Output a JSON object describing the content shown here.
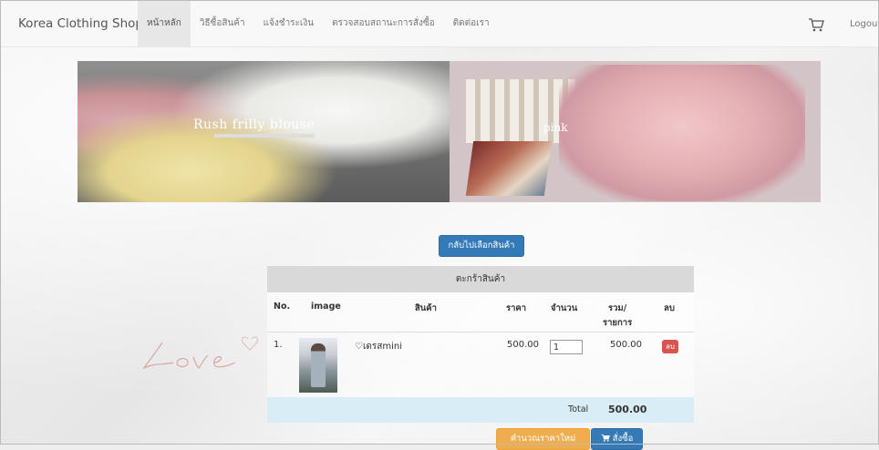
{
  "navbar": {
    "brand": "Korea Clothing Shop",
    "items": [
      {
        "label": "หน้าหลัก",
        "active": true
      },
      {
        "label": "วิธีซื้อสินค้า",
        "active": false
      },
      {
        "label": "แจ้งชำระเงิน",
        "active": false
      },
      {
        "label": "ตรวจสอบสถานะการสั่งซื้อ",
        "active": false
      },
      {
        "label": "ติดต่อเรา",
        "active": false
      }
    ],
    "cart_icon": "cart-icon",
    "logout": "Logout"
  },
  "banner": {
    "left_caption": "Rush frilly blouse",
    "right_caption": "pink"
  },
  "back_button": "กลับไปเลือกสินค้า",
  "cart": {
    "title": "ตะกร้าสินค้า",
    "headers": {
      "no": "No.",
      "image": "image",
      "product": "สินค้า",
      "price": "ราคา",
      "qty": "จำนวน",
      "subtotal_1": "รวม/",
      "subtotal_2": "รายการ",
      "delete": "ลบ"
    },
    "rows": [
      {
        "no": "1.",
        "name": "♡เดรสmini",
        "price": "500.00",
        "qty": "1",
        "subtotal": "500.00",
        "delete": "ลบ"
      }
    ],
    "total_label": "Total",
    "total_value": "500.00"
  },
  "actions": {
    "recalc": "คำนวณราคาใหม่",
    "order": "สั่งซื้อ"
  },
  "colors": {
    "primary": "#337ab7",
    "warning": "#f0ad4e",
    "danger": "#d9534f",
    "total_row": "#d9edf7"
  }
}
